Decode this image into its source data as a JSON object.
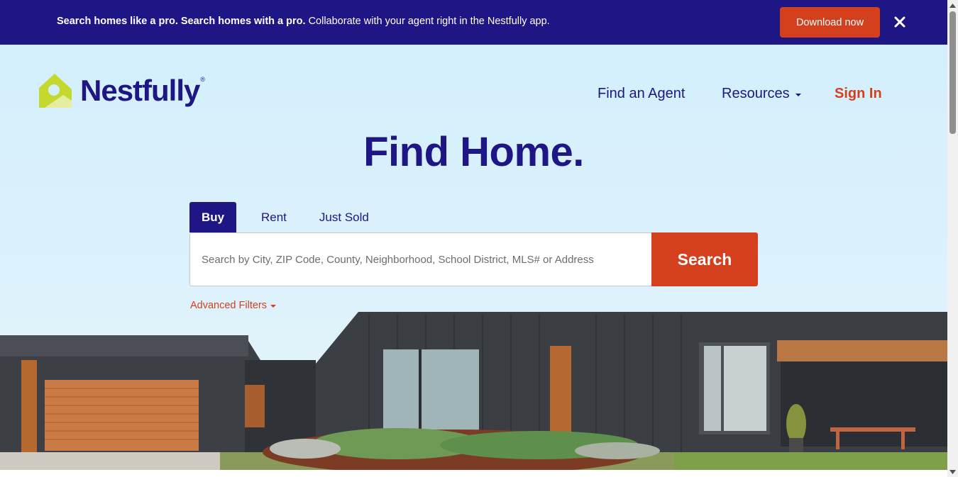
{
  "banner": {
    "bold_text": "Search homes like a pro. Search homes with a pro.",
    "text": " Collaborate with your agent right in the Nestfully app.",
    "cta_label": "Download now",
    "close_icon": "close-icon"
  },
  "brand": {
    "name": "Nestfully",
    "registered": "®",
    "logo_icon": "house-tag-icon",
    "colors": {
      "navy": "#1f1685",
      "accent": "#d43f1e",
      "logo_green": "#c5d82e"
    }
  },
  "nav": {
    "find_agent": "Find an Agent",
    "resources": "Resources",
    "sign_in": "Sign In"
  },
  "hero": {
    "title": "Find Home."
  },
  "search": {
    "tabs": [
      {
        "label": "Buy",
        "active": true
      },
      {
        "label": "Rent",
        "active": false
      },
      {
        "label": "Just Sold",
        "active": false
      }
    ],
    "placeholder": "Search by City, ZIP Code, County, Neighborhood, School District, MLS# or Address",
    "button_label": "Search",
    "advanced_filters": "Advanced Filters"
  }
}
